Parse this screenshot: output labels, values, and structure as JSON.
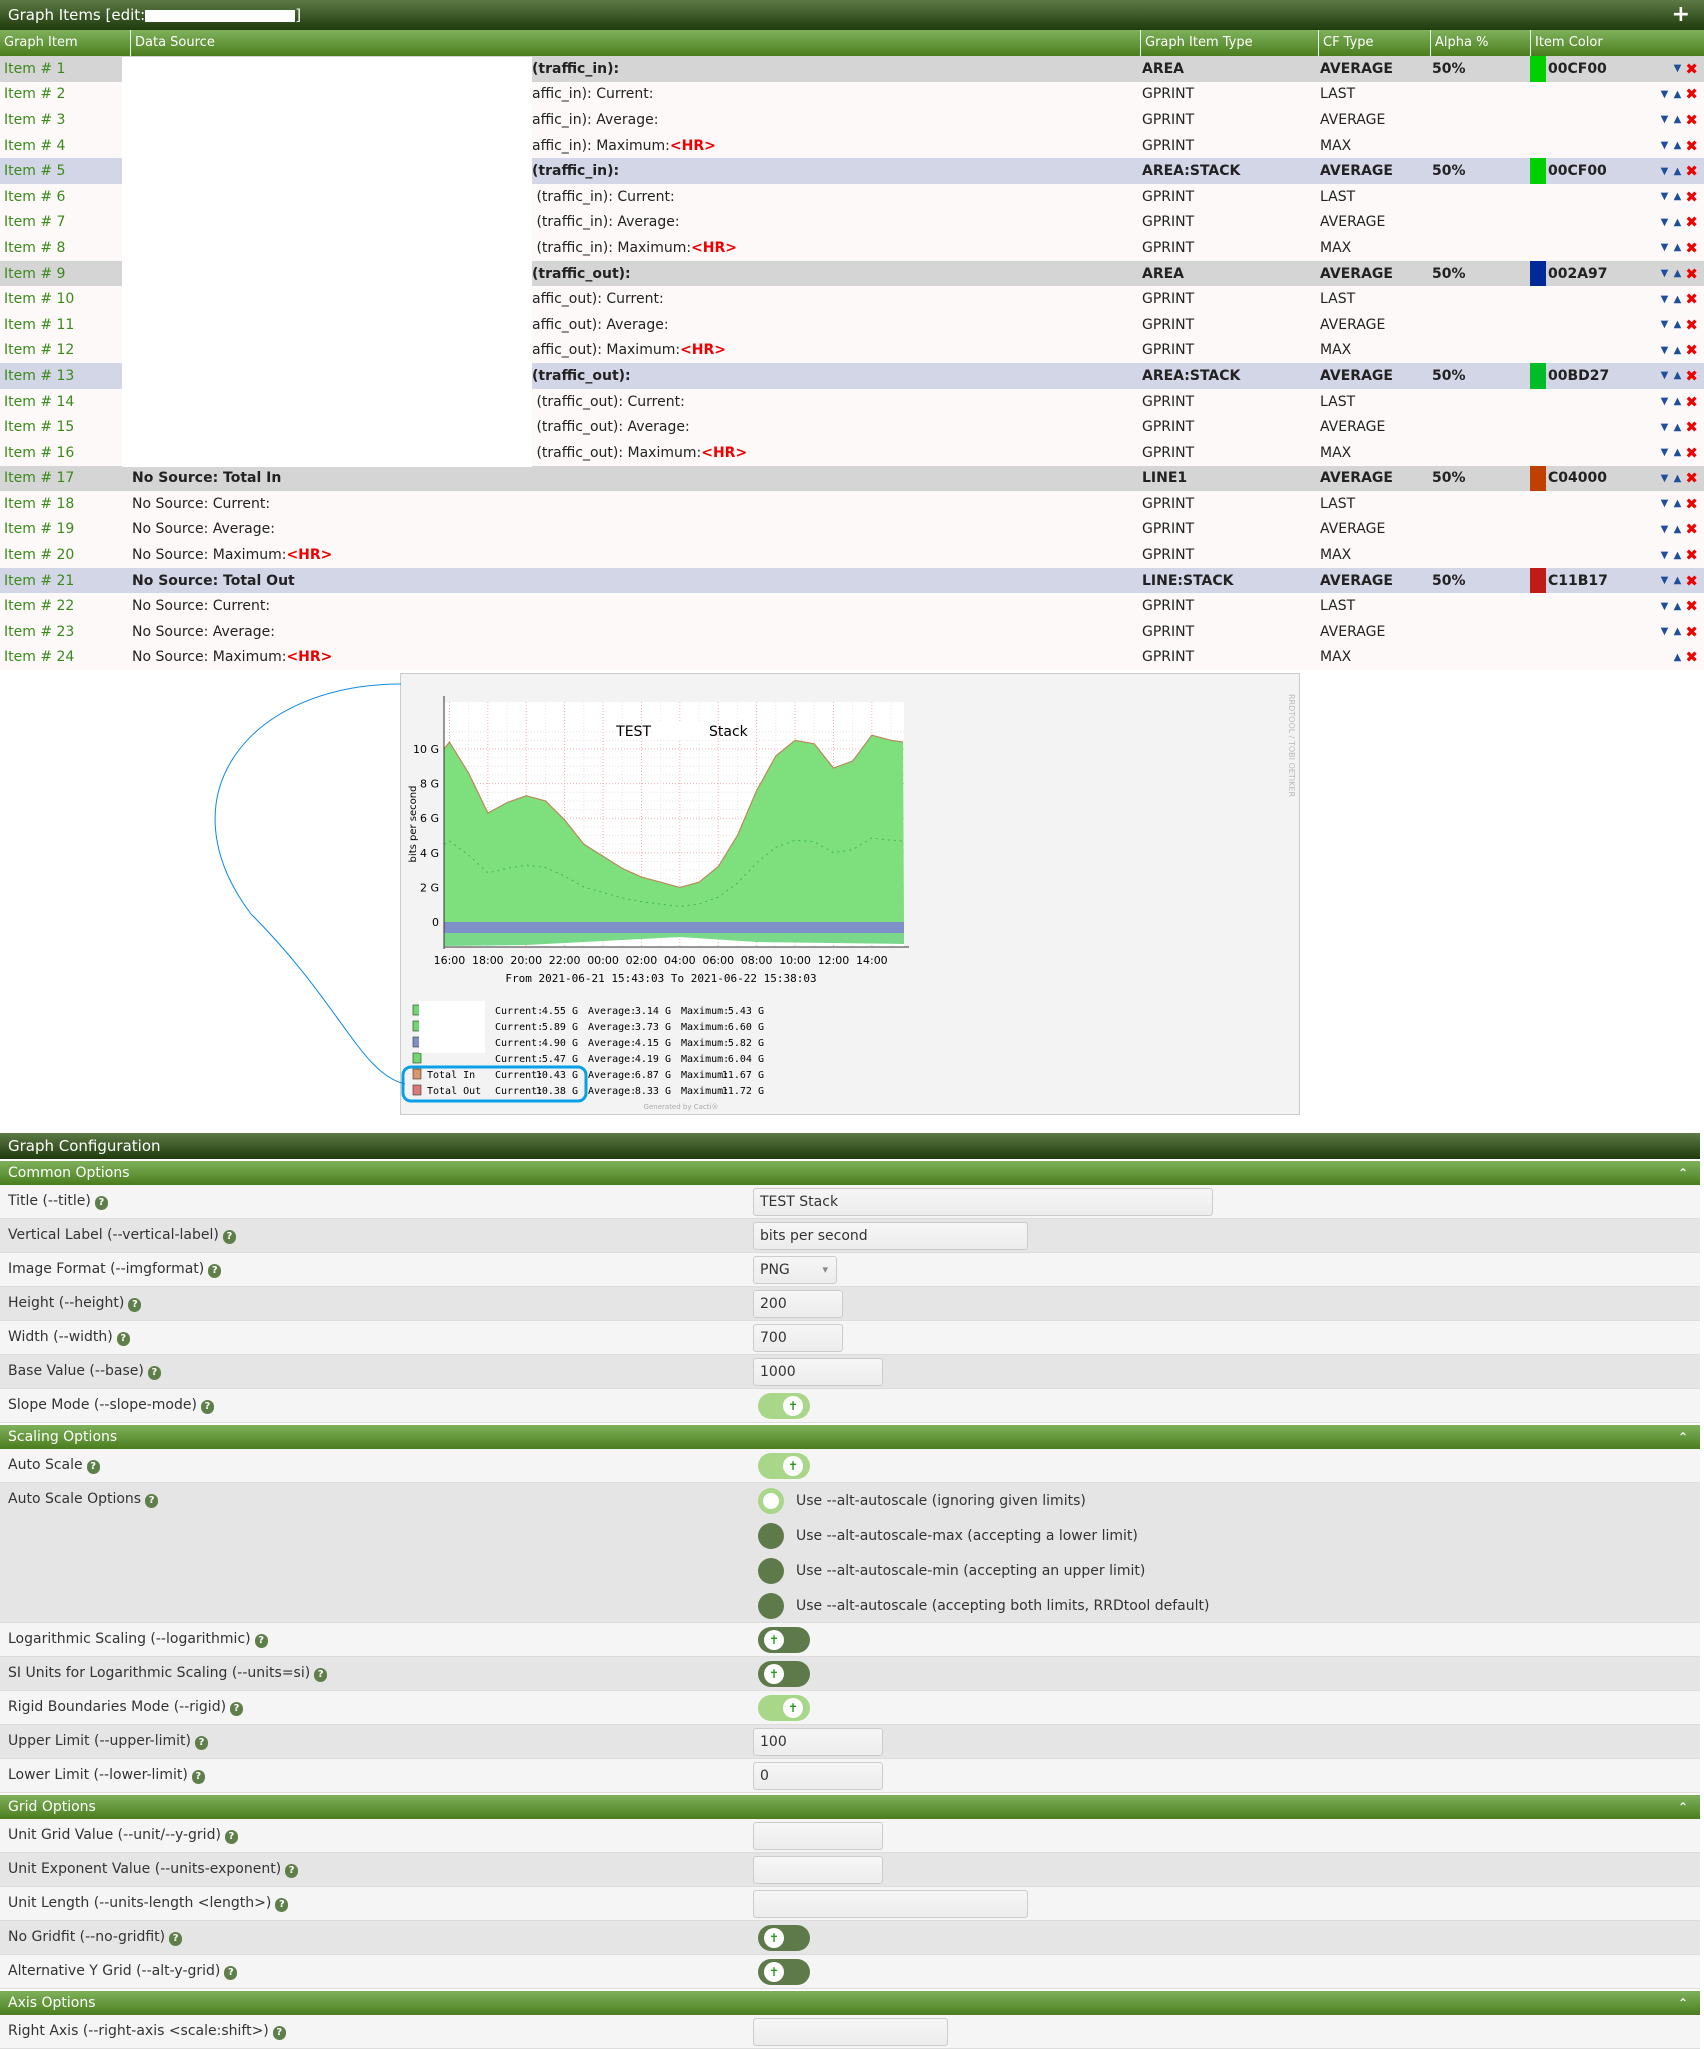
{
  "header": {
    "title": "Graph Items [edit:",
    "add_icon": "plus-icon"
  },
  "columns": [
    "Graph Item",
    "Data Source",
    "Graph Item Type",
    "CF Type",
    "Alpha %",
    "Item Color"
  ],
  "items": [
    {
      "label": "Item # 1",
      "source": "(traffic_in):",
      "type": "AREA",
      "cf": "AVERAGE",
      "alpha": "50%",
      "color": "00CF00",
      "bg": "g",
      "primary": true
    },
    {
      "label": "Item # 2",
      "source": "affic_in): Current:",
      "type": "GPRINT",
      "cf": "LAST"
    },
    {
      "label": "Item # 3",
      "source": "affic_in): Average:",
      "type": "GPRINT",
      "cf": "AVERAGE"
    },
    {
      "label": "Item # 4",
      "source": "affic_in): Maximum:",
      "hr": "<HR>",
      "type": "GPRINT",
      "cf": "MAX"
    },
    {
      "label": "Item # 5",
      "source": "(traffic_in):",
      "type": "AREA:STACK",
      "cf": "AVERAGE",
      "alpha": "50%",
      "color": "00CF00",
      "bg": "b",
      "primary": true
    },
    {
      "label": "Item # 6",
      "source": " (traffic_in): Current:",
      "type": "GPRINT",
      "cf": "LAST"
    },
    {
      "label": "Item # 7",
      "source": " (traffic_in): Average:",
      "type": "GPRINT",
      "cf": "AVERAGE"
    },
    {
      "label": "Item # 8",
      "source": " (traffic_in): Maximum:",
      "hr": "<HR>",
      "type": "GPRINT",
      "cf": "MAX"
    },
    {
      "label": "Item # 9",
      "source": "(traffic_out):",
      "type": "AREA",
      "cf": "AVERAGE",
      "alpha": "50%",
      "color": "002A97",
      "bg": "g",
      "primary": true
    },
    {
      "label": "Item # 10",
      "source": "affic_out): Current:",
      "type": "GPRINT",
      "cf": "LAST"
    },
    {
      "label": "Item # 11",
      "source": "affic_out): Average:",
      "type": "GPRINT",
      "cf": "AVERAGE"
    },
    {
      "label": "Item # 12",
      "source": "affic_out): Maximum:",
      "hr": "<HR>",
      "type": "GPRINT",
      "cf": "MAX"
    },
    {
      "label": "Item # 13",
      "source": "(traffic_out):",
      "type": "AREA:STACK",
      "cf": "AVERAGE",
      "alpha": "50%",
      "color": "00BD27",
      "bg": "b",
      "primary": true
    },
    {
      "label": "Item # 14",
      "source": " (traffic_out): Current:",
      "type": "GPRINT",
      "cf": "LAST"
    },
    {
      "label": "Item # 15",
      "source": " (traffic_out): Average:",
      "type": "GPRINT",
      "cf": "AVERAGE"
    },
    {
      "label": "Item # 16",
      "source": " (traffic_out): Maximum:",
      "hr": "<HR>",
      "type": "GPRINT",
      "cf": "MAX"
    },
    {
      "label": "Item # 17",
      "source": "No Source: Total In",
      "type": "LINE1",
      "cf": "AVERAGE",
      "alpha": "50%",
      "color": "C04000",
      "bg": "g",
      "primary": true
    },
    {
      "label": "Item # 18",
      "source": "No Source: Current:",
      "type": "GPRINT",
      "cf": "LAST"
    },
    {
      "label": "Item # 19",
      "source": "No Source: Average:",
      "type": "GPRINT",
      "cf": "AVERAGE"
    },
    {
      "label": "Item # 20",
      "source": "No Source: Maximum:",
      "hr": "<HR>",
      "type": "GPRINT",
      "cf": "MAX"
    },
    {
      "label": "Item # 21",
      "source": "No Source: Total Out",
      "type": "LINE:STACK",
      "cf": "AVERAGE",
      "alpha": "50%",
      "color": "C11B17",
      "bg": "b",
      "primary": true
    },
    {
      "label": "Item # 22",
      "source": "No Source: Current:",
      "type": "GPRINT",
      "cf": "LAST"
    },
    {
      "label": "Item # 23",
      "source": "No Source: Average:",
      "type": "GPRINT",
      "cf": "AVERAGE"
    },
    {
      "label": "Item # 24",
      "source": "No Source: Maximum:",
      "hr": "<HR>",
      "type": "GPRINT",
      "cf": "MAX"
    }
  ],
  "graph": {
    "title_left": "TEST",
    "title_right": "Stack",
    "ylabel": "bits per second",
    "side_text": "RRDTOOL / TOBI OETIKER",
    "range": "From 2021-06-21 15:43:03 To 2021-06-22 15:38:03",
    "footer": "Generated by Cacti®",
    "yticks": [
      "10 G",
      "8 G",
      "6 G",
      "4 G",
      "2 G",
      "0"
    ],
    "xticks": [
      "16:00",
      "18:00",
      "20:00",
      "22:00",
      "00:00",
      "02:00",
      "04:00",
      "06:00",
      "08:00",
      "10:00",
      "12:00",
      "14:00"
    ],
    "total_in_g": [
      [
        15.72,
        10.0
      ],
      [
        16,
        10.4
      ],
      [
        17,
        8.6
      ],
      [
        18,
        6.3
      ],
      [
        19,
        6.9
      ],
      [
        20,
        7.3
      ],
      [
        21,
        7.0
      ],
      [
        22,
        5.9
      ],
      [
        23,
        4.5
      ],
      [
        0,
        3.8
      ],
      [
        1,
        3.1
      ],
      [
        2,
        2.6
      ],
      [
        3,
        2.3
      ],
      [
        4,
        2.0
      ],
      [
        5,
        2.3
      ],
      [
        6,
        3.2
      ],
      [
        7,
        5.0
      ],
      [
        8,
        7.6
      ],
      [
        9,
        9.6
      ],
      [
        10,
        10.5
      ],
      [
        11,
        10.3
      ],
      [
        12,
        8.9
      ],
      [
        13,
        9.3
      ],
      [
        14,
        10.8
      ],
      [
        15,
        10.5
      ],
      [
        15.63,
        10.4
      ]
    ],
    "legend": [
      {
        "label": "",
        "color": "#6fd86f",
        "cur": "4.55 G",
        "avg": "3.14 G",
        "max": "5.43 G"
      },
      {
        "label": "",
        "color": "#6fd86f",
        "cur": "5.89 G",
        "avg": "3.73 G",
        "max": "6.60 G"
      },
      {
        "label": "",
        "color": "#7f8fc8",
        "cur": "4.90 G",
        "avg": "4.15 G",
        "max": "5.82 G"
      },
      {
        "label": "",
        "color": "#6fd86f",
        "cur": "5.47 G",
        "avg": "4.19 G",
        "max": "6.04 G"
      },
      {
        "label": "Total In",
        "color": "#d9976a",
        "cur": "10.43 G",
        "avg": "6.87 G",
        "max": "11.67 G"
      },
      {
        "label": "Total Out",
        "color": "#d97b7b",
        "cur": "10.38 G",
        "avg": "8.33 G",
        "max": "11.72 G"
      }
    ],
    "cur_label": "Current:",
    "avg_label": "Average:",
    "max_label": "Maximum:"
  },
  "config": {
    "title": "Graph Configuration",
    "sections": [
      {
        "name": "Common Options",
        "rows": [
          {
            "label": "Title (--title)",
            "kind": "input",
            "value": "TEST          Stack",
            "w": 460
          },
          {
            "label": "Vertical Label (--vertical-label)",
            "kind": "input",
            "value": "bits per second",
            "w": 275
          },
          {
            "label": "Image Format (--imgformat)",
            "kind": "select",
            "value": "PNG",
            "w": 84
          },
          {
            "label": "Height (--height)",
            "kind": "input",
            "value": "200",
            "w": 90
          },
          {
            "label": "Width (--width)",
            "kind": "input",
            "value": "700",
            "w": 90
          },
          {
            "label": "Base Value (--base)",
            "kind": "input",
            "value": "1000",
            "w": 130
          },
          {
            "label": "Slope Mode (--slope-mode)",
            "kind": "toggle",
            "on": true
          }
        ]
      },
      {
        "name": "Scaling Options",
        "rows": [
          {
            "label": "Auto Scale",
            "kind": "toggle",
            "on": true
          },
          {
            "label": "Auto Scale Options",
            "kind": "radios",
            "options": [
              "Use --alt-autoscale (ignoring given limits)",
              "Use --alt-autoscale-max (accepting a lower limit)",
              "Use --alt-autoscale-min (accepting an upper limit)",
              "Use --alt-autoscale (accepting both limits, RRDtool default)"
            ],
            "selected": 0
          },
          {
            "label": "Logarithmic Scaling (--logarithmic)",
            "kind": "toggle",
            "on": false
          },
          {
            "label": "SI Units for Logarithmic Scaling (--units=si)",
            "kind": "toggle",
            "on": false
          },
          {
            "label": "Rigid Boundaries Mode (--rigid)",
            "kind": "toggle",
            "on": true
          },
          {
            "label": "Upper Limit (--upper-limit)",
            "kind": "input",
            "value": "100",
            "w": 130
          },
          {
            "label": "Lower Limit (--lower-limit)",
            "kind": "input",
            "value": "0",
            "w": 130
          }
        ]
      },
      {
        "name": "Grid Options",
        "rows": [
          {
            "label": "Unit Grid Value (--unit/--y-grid)",
            "kind": "input",
            "value": "",
            "w": 130
          },
          {
            "label": "Unit Exponent Value (--units-exponent)",
            "kind": "input",
            "value": "",
            "w": 130
          },
          {
            "label": "Unit Length (--units-length <length>)",
            "kind": "input",
            "value": "",
            "w": 275
          },
          {
            "label": "No Gridfit (--no-gridfit)",
            "kind": "toggle",
            "on": false
          },
          {
            "label": "Alternative Y Grid (--alt-y-grid)",
            "kind": "toggle",
            "on": false
          }
        ]
      },
      {
        "name": "Axis Options",
        "rows": [
          {
            "label": "Right Axis (--right-axis <scale:shift>)",
            "kind": "input",
            "value": "",
            "w": 195
          }
        ]
      }
    ]
  }
}
